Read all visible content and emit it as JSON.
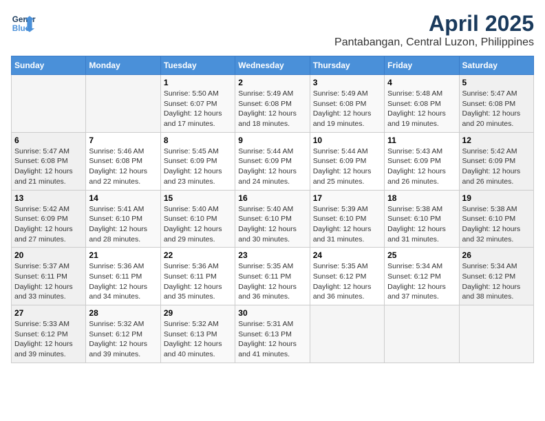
{
  "header": {
    "logo_line1": "General",
    "logo_line2": "Blue",
    "title": "April 2025",
    "subtitle": "Pantabangan, Central Luzon, Philippines"
  },
  "weekdays": [
    "Sunday",
    "Monday",
    "Tuesday",
    "Wednesday",
    "Thursday",
    "Friday",
    "Saturday"
  ],
  "weeks": [
    [
      {
        "day": "",
        "info": ""
      },
      {
        "day": "",
        "info": ""
      },
      {
        "day": "1",
        "info": "Sunrise: 5:50 AM\nSunset: 6:07 PM\nDaylight: 12 hours and 17 minutes."
      },
      {
        "day": "2",
        "info": "Sunrise: 5:49 AM\nSunset: 6:08 PM\nDaylight: 12 hours and 18 minutes."
      },
      {
        "day": "3",
        "info": "Sunrise: 5:49 AM\nSunset: 6:08 PM\nDaylight: 12 hours and 19 minutes."
      },
      {
        "day": "4",
        "info": "Sunrise: 5:48 AM\nSunset: 6:08 PM\nDaylight: 12 hours and 19 minutes."
      },
      {
        "day": "5",
        "info": "Sunrise: 5:47 AM\nSunset: 6:08 PM\nDaylight: 12 hours and 20 minutes."
      }
    ],
    [
      {
        "day": "6",
        "info": "Sunrise: 5:47 AM\nSunset: 6:08 PM\nDaylight: 12 hours and 21 minutes."
      },
      {
        "day": "7",
        "info": "Sunrise: 5:46 AM\nSunset: 6:08 PM\nDaylight: 12 hours and 22 minutes."
      },
      {
        "day": "8",
        "info": "Sunrise: 5:45 AM\nSunset: 6:09 PM\nDaylight: 12 hours and 23 minutes."
      },
      {
        "day": "9",
        "info": "Sunrise: 5:44 AM\nSunset: 6:09 PM\nDaylight: 12 hours and 24 minutes."
      },
      {
        "day": "10",
        "info": "Sunrise: 5:44 AM\nSunset: 6:09 PM\nDaylight: 12 hours and 25 minutes."
      },
      {
        "day": "11",
        "info": "Sunrise: 5:43 AM\nSunset: 6:09 PM\nDaylight: 12 hours and 26 minutes."
      },
      {
        "day": "12",
        "info": "Sunrise: 5:42 AM\nSunset: 6:09 PM\nDaylight: 12 hours and 26 minutes."
      }
    ],
    [
      {
        "day": "13",
        "info": "Sunrise: 5:42 AM\nSunset: 6:09 PM\nDaylight: 12 hours and 27 minutes."
      },
      {
        "day": "14",
        "info": "Sunrise: 5:41 AM\nSunset: 6:10 PM\nDaylight: 12 hours and 28 minutes."
      },
      {
        "day": "15",
        "info": "Sunrise: 5:40 AM\nSunset: 6:10 PM\nDaylight: 12 hours and 29 minutes."
      },
      {
        "day": "16",
        "info": "Sunrise: 5:40 AM\nSunset: 6:10 PM\nDaylight: 12 hours and 30 minutes."
      },
      {
        "day": "17",
        "info": "Sunrise: 5:39 AM\nSunset: 6:10 PM\nDaylight: 12 hours and 31 minutes."
      },
      {
        "day": "18",
        "info": "Sunrise: 5:38 AM\nSunset: 6:10 PM\nDaylight: 12 hours and 31 minutes."
      },
      {
        "day": "19",
        "info": "Sunrise: 5:38 AM\nSunset: 6:10 PM\nDaylight: 12 hours and 32 minutes."
      }
    ],
    [
      {
        "day": "20",
        "info": "Sunrise: 5:37 AM\nSunset: 6:11 PM\nDaylight: 12 hours and 33 minutes."
      },
      {
        "day": "21",
        "info": "Sunrise: 5:36 AM\nSunset: 6:11 PM\nDaylight: 12 hours and 34 minutes."
      },
      {
        "day": "22",
        "info": "Sunrise: 5:36 AM\nSunset: 6:11 PM\nDaylight: 12 hours and 35 minutes."
      },
      {
        "day": "23",
        "info": "Sunrise: 5:35 AM\nSunset: 6:11 PM\nDaylight: 12 hours and 36 minutes."
      },
      {
        "day": "24",
        "info": "Sunrise: 5:35 AM\nSunset: 6:12 PM\nDaylight: 12 hours and 36 minutes."
      },
      {
        "day": "25",
        "info": "Sunrise: 5:34 AM\nSunset: 6:12 PM\nDaylight: 12 hours and 37 minutes."
      },
      {
        "day": "26",
        "info": "Sunrise: 5:34 AM\nSunset: 6:12 PM\nDaylight: 12 hours and 38 minutes."
      }
    ],
    [
      {
        "day": "27",
        "info": "Sunrise: 5:33 AM\nSunset: 6:12 PM\nDaylight: 12 hours and 39 minutes."
      },
      {
        "day": "28",
        "info": "Sunrise: 5:32 AM\nSunset: 6:12 PM\nDaylight: 12 hours and 39 minutes."
      },
      {
        "day": "29",
        "info": "Sunrise: 5:32 AM\nSunset: 6:13 PM\nDaylight: 12 hours and 40 minutes."
      },
      {
        "day": "30",
        "info": "Sunrise: 5:31 AM\nSunset: 6:13 PM\nDaylight: 12 hours and 41 minutes."
      },
      {
        "day": "",
        "info": ""
      },
      {
        "day": "",
        "info": ""
      },
      {
        "day": "",
        "info": ""
      }
    ]
  ]
}
